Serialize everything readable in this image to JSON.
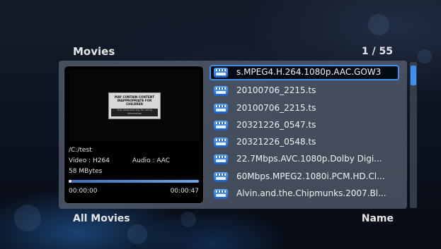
{
  "header": {
    "section_title": "Movies",
    "page_count": "1 / 55"
  },
  "preview": {
    "rating_top": "MAY CONTAIN CONTENT INAPPROPRIATE FOR CHILDREN",
    "rating_bottom": "Visit www.esrb.org for rating information",
    "path": "/C:/test",
    "video": "Video : H264",
    "audio": "Audio : AAC",
    "size": "58 MBytes",
    "progress_fraction": 0.02,
    "time_current": "00:00:00",
    "time_total": "00:00:47"
  },
  "files": [
    {
      "name": "s.MPEG4.H.264.1080p.AAC.GOW3",
      "icon": "video-file-icon",
      "selected": true
    },
    {
      "name": "20100706_2215.ts",
      "icon": "video-file-icon",
      "selected": false
    },
    {
      "name": "20100706_2215.ts",
      "icon": "video-file-icon",
      "selected": false
    },
    {
      "name": "20321226_0547.ts",
      "icon": "video-file-icon",
      "selected": false
    },
    {
      "name": "20321226_0548.ts",
      "icon": "video-file-icon",
      "selected": false
    },
    {
      "name": "22.7Mbps.AVC.1080p.Dolby Digi...",
      "icon": "video-file-icon",
      "selected": false
    },
    {
      "name": "60Mbps.MPEG2.1080i.PCM.HD.Cl...",
      "icon": "video-file-icon",
      "selected": false
    },
    {
      "name": "Alvin.and.the.Chipmunks.2007.Bl...",
      "icon": "video-file-icon",
      "selected": false
    }
  ],
  "footer": {
    "filter_label": "All Movies",
    "sort_label": "Name"
  },
  "colors": {
    "accent": "#3d8ff0",
    "panel": "#5a6473"
  }
}
